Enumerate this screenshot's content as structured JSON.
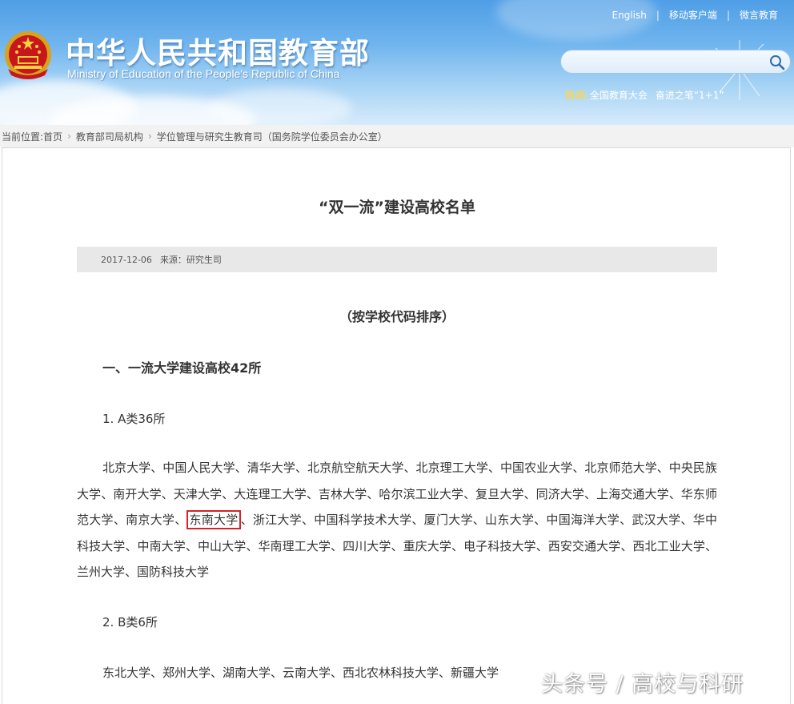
{
  "header": {
    "site_title_cn": "中华人民共和国教育部",
    "site_title_en": "Ministry of Education of the People's Republic of China",
    "toplinks": [
      "English",
      "移动客户端",
      "微言教育"
    ],
    "search": {
      "placeholder": ""
    },
    "hotwords": {
      "label": "热词:",
      "items": [
        "全国教育大会",
        "奋进之笔“1+1”"
      ]
    }
  },
  "breadcrumb": {
    "prefix": "当前位置:",
    "items": [
      "首页",
      "教育部司局机构",
      "学位管理与研究生教育司（国务院学位委员会办公室）"
    ]
  },
  "article": {
    "title": "“双一流”建设高校名单",
    "date": "2017-12-06",
    "source": "来源：研究生司",
    "subtitle": "（按学校代码排序）",
    "section1": "一、一流大学建设高校42所",
    "groupA_title": "1. A类36所",
    "groupA_before": "北京大学、中国人民大学、清华大学、北京航空航天大学、北京理工大学、中国农业大学、北京师范大学、中央民族大学、南开大学、天津大学、大连理工大学、吉林大学、哈尔滨工业大学、复旦大学、同济大学、上海交通大学、华东师范大学、南京大学、",
    "groupA_highlight": "东南大学",
    "groupA_after": "、浙江大学、中国科学技术大学、厦门大学、山东大学、中国海洋大学、武汉大学、华中科技大学、中南大学、中山大学、华南理工大学、四川大学、重庆大学、电子科技大学、西安交通大学、西北工业大学、兰州大学、国防科技大学",
    "groupB_title": "2. B类6所",
    "groupB_text": "东北大学、郑州大学、湖南大学、云南大学、西北农林科技大学、新疆大学"
  },
  "watermark": "头条号 / 高校与科研",
  "colors": {
    "header_blue": "#4f9ee6",
    "highlight_red": "#d8222b",
    "hotword_gold": "#f5d65a"
  }
}
